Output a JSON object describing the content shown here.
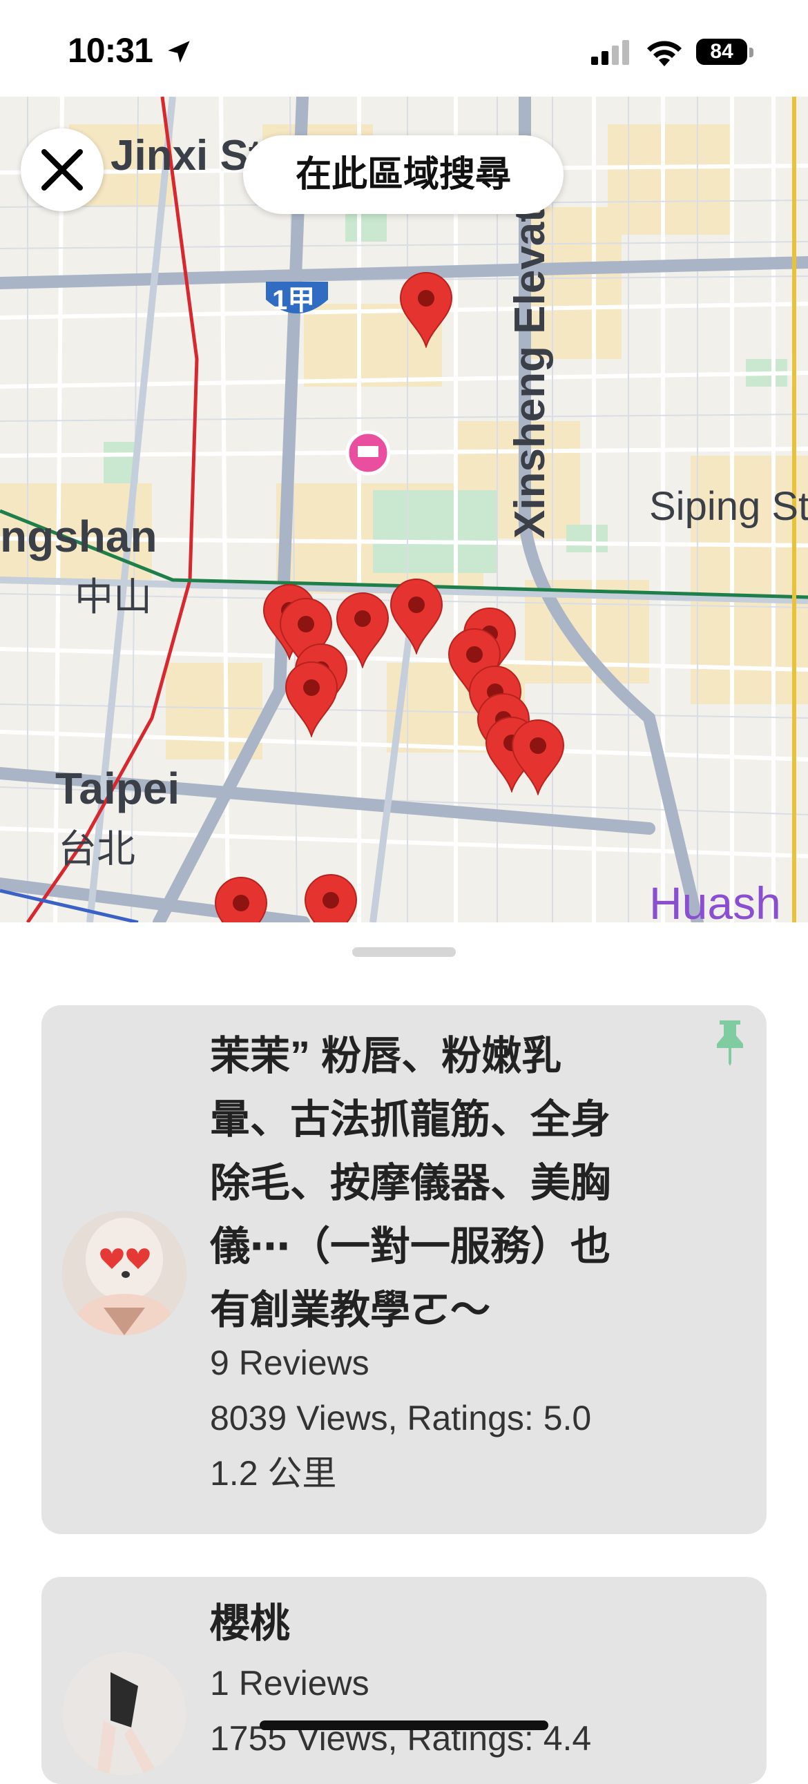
{
  "status_bar": {
    "time": "10:31",
    "battery": "84"
  },
  "map": {
    "search_area_label": "在此區域搜尋",
    "labels": {
      "jinxi": "Jinxi St",
      "xinsheng": "Xinsheng Elevated",
      "siping": "Siping St",
      "zhongshan_en": "ngshan",
      "zhongshan_zh": "中山",
      "taipei_en": "Taipei",
      "taipei_zh": "台北",
      "huashan": "Huash",
      "route_badge": "1甲"
    }
  },
  "listings": [
    {
      "title": "茉茉” 粉唇、粉嫩乳暈、古法抓龍筋、全身除毛、按摩儀器、美胸儀⋯（一對一服務）也有創業教學ㄛ～",
      "title_lines": [
        "茉茉” 粉唇、粉嫩乳",
        "暈、古法抓龍筋、全身",
        "除毛、按摩儀器、美胸",
        "儀⋯（一對一服務）也",
        "有創業教學ㄛ～"
      ],
      "reviews": "9 Reviews",
      "views_ratings": "8039 Views, Ratings: 5.0",
      "distance": "1.2 公里",
      "pinned": true
    },
    {
      "title": "櫻桃",
      "reviews": "1 Reviews",
      "views_ratings": "1755 Views, Ratings: 4.4"
    }
  ]
}
